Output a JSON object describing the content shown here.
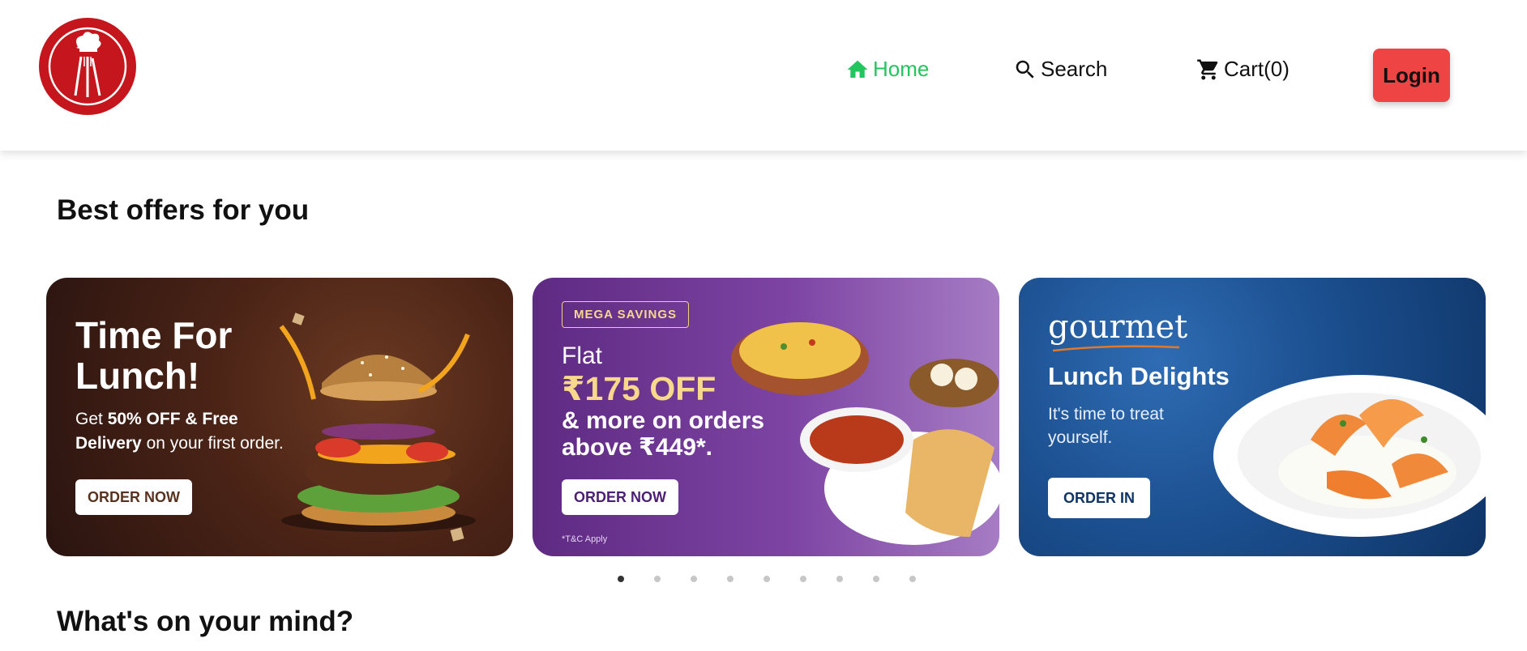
{
  "header": {
    "logo_alt": "chef-logo",
    "nav": [
      {
        "label": "Home",
        "icon": "home-icon",
        "active": true
      },
      {
        "label": "Search",
        "icon": "search-icon"
      },
      {
        "label": "Cart(0)",
        "icon": "cart-icon"
      }
    ],
    "login_label": "Login",
    "active_color": "#22c55e",
    "login_color": "#ef4444"
  },
  "offers": {
    "title": "Best offers for you",
    "cards": [
      {
        "headline": "Time For Lunch!",
        "sub_pre": "Get ",
        "sub_bold": "50% OFF & Free Delivery",
        "sub_post": " on your first order.",
        "button": "ORDER NOW"
      },
      {
        "badge": "MEGA SAVINGS",
        "flat": "Flat",
        "amount": "₹175 OFF",
        "more": "& more on orders above ₹449*.",
        "button": "ORDER NOW",
        "tc": "*T&C Apply"
      },
      {
        "brand": "gourmet",
        "headline": "Lunch Delights",
        "sub": "It's time to treat yourself.",
        "button": "ORDER IN"
      }
    ],
    "carousel": {
      "total_dots": 9,
      "active_index": 0
    }
  },
  "mind": {
    "title": "What's on your mind?"
  }
}
